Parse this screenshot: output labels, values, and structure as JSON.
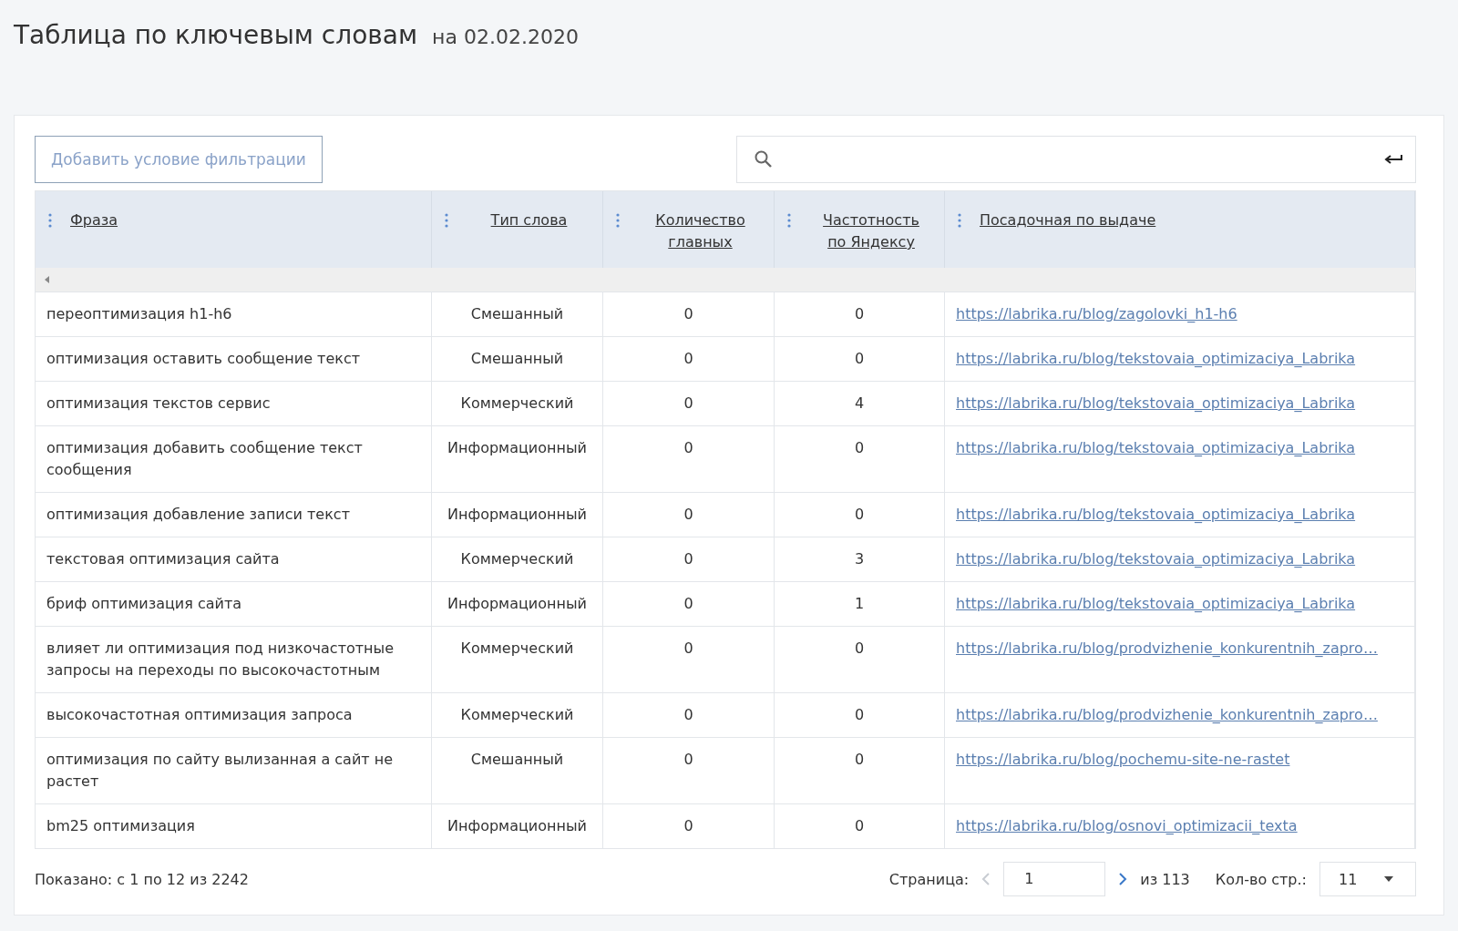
{
  "title": "Таблица по ключевым словам",
  "date": "на 02.02.2020",
  "filter_button": "Добавить условие фильтрации",
  "table": {
    "columns": [
      {
        "label": "Фраза",
        "kind": "text"
      },
      {
        "label": "Тип слова",
        "kind": "category"
      },
      {
        "label": "Количество главных",
        "kind": "number"
      },
      {
        "label": "Частотность по Яндексу",
        "kind": "number"
      },
      {
        "label": "Посадочная по выдаче",
        "kind": "link"
      }
    ],
    "rows": [
      [
        "переоптимизация h1-h6",
        "Смешанный",
        "0",
        "0",
        "https://labrika.ru/blog/zagolovki_h1-h6"
      ],
      [
        "оптимизация оставить сообщение текст",
        "Смешанный",
        "0",
        "0",
        "https://labrika.ru/blog/tekstovaia_optimizaciya_Labrika"
      ],
      [
        "оптимизация текстов сервис",
        "Коммерческий",
        "0",
        "4",
        "https://labrika.ru/blog/tekstovaia_optimizaciya_Labrika"
      ],
      [
        "оптимизация добавить сообщение текст сообщения",
        "Информационный",
        "0",
        "0",
        "https://labrika.ru/blog/tekstovaia_optimizaciya_Labrika"
      ],
      [
        "оптимизация добавление записи текст",
        "Информационный",
        "0",
        "0",
        "https://labrika.ru/blog/tekstovaia_optimizaciya_Labrika"
      ],
      [
        "текстовая оптимизация сайта",
        "Коммерческий",
        "0",
        "3",
        "https://labrika.ru/blog/tekstovaia_optimizaciya_Labrika"
      ],
      [
        "бриф оптимизация сайта",
        "Информационный",
        "0",
        "1",
        "https://labrika.ru/blog/tekstovaia_optimizaciya_Labrika"
      ],
      [
        "влияет ли оптимизация под низкочастотные запросы на переходы по высокочастотным",
        "Коммерческий",
        "0",
        "0",
        "https://labrika.ru/blog/prodvizhenie_konkurentnih_zapro…"
      ],
      [
        "высокочастотная оптимизация запроса",
        "Коммерческий",
        "0",
        "0",
        "https://labrika.ru/blog/prodvizhenie_konkurentnih_zapro…"
      ],
      [
        "оптимизация по сайту вылизанная а сайт не растет",
        "Смешанный",
        "0",
        "0",
        "https://labrika.ru/blog/pochemu-site-ne-rastet"
      ],
      [
        "bm25 оптимизация",
        "Информационный",
        "0",
        "0",
        "https://labrika.ru/blog/osnovi_optimizacii_texta"
      ]
    ]
  },
  "footer": {
    "shown": "Показано: с 1 по 12 из 2242",
    "page_label": "Страница:",
    "prev_disabled": true,
    "next_disabled": false,
    "page": "1",
    "of_pages": "из 113",
    "per_page_label": "Кол-во стр.:",
    "per_page": "11"
  }
}
